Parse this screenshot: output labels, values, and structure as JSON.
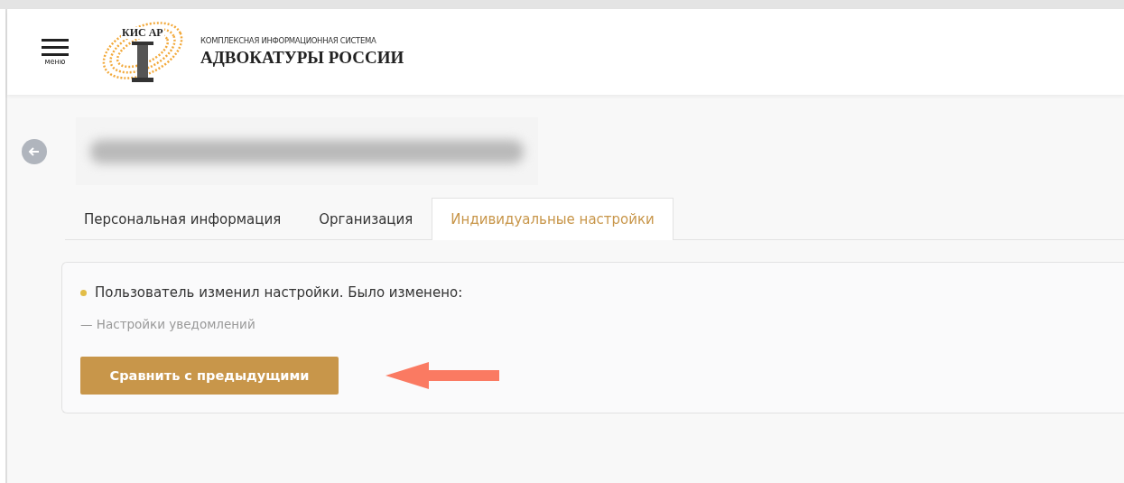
{
  "header": {
    "menu_label": "меню",
    "logo_text": "КИС АР",
    "subtitle": "КОМПЛЕКСНАЯ ИНФОРМАЦИОННАЯ СИСТЕМА",
    "title": "АДВОКАТУРЫ РОССИИ"
  },
  "tabs": [
    {
      "label": "Персональная информация",
      "selected": false
    },
    {
      "label": "Организация",
      "selected": false
    },
    {
      "label": "Индивидуальные настройки",
      "selected": true
    }
  ],
  "notice": {
    "color": "#e2bd47",
    "message": "Пользователь изменил настройки. Было изменено:",
    "changes": [
      "— Настройки уведомлений"
    ],
    "button": "Сравнить с предыдущими"
  }
}
